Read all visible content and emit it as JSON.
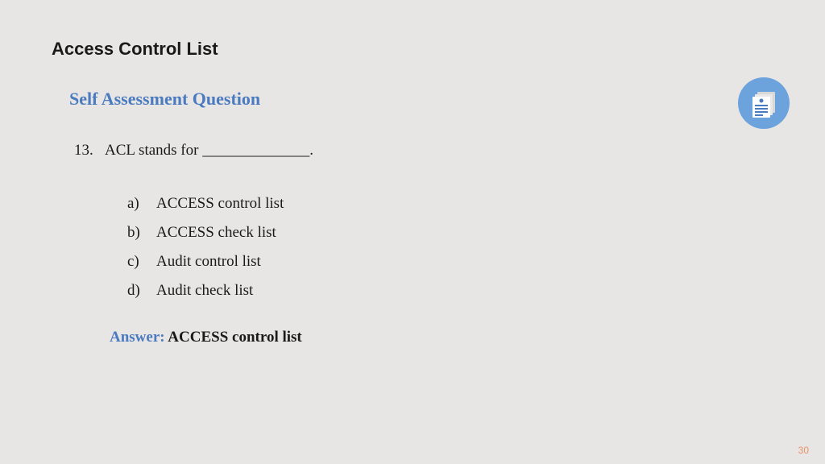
{
  "title": "Access Control List",
  "subtitle": "Self Assessment Question",
  "question": {
    "number": "13.",
    "text": "ACL stands for ______________."
  },
  "options": [
    {
      "letter": "a)",
      "text": "ACCESS control list"
    },
    {
      "letter": "b)",
      "text": "ACCESS check list"
    },
    {
      "letter": "c)",
      "text": "Audit control list"
    },
    {
      "letter": "d)",
      "text": "Audit check list"
    }
  ],
  "answer": {
    "label": "Answer:",
    "text": "  ACCESS control list"
  },
  "pageNumber": "30"
}
